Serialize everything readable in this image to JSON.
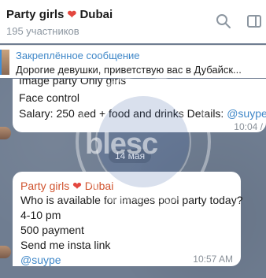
{
  "header": {
    "title": "Party girls",
    "title_emoji": "❤",
    "title_city": "Dubai",
    "subtitle": "195 участников"
  },
  "pinned": {
    "label": "Закреплённое сообщение",
    "text": "Дорогие девушки, приветствую вас в Дубайск..."
  },
  "messages": [
    {
      "lines": [
        "Image party Only girls",
        "Face control",
        "Salary: 250 aed + food and drinks Details: "
      ],
      "handle": "@suype",
      "time": "10:04 /"
    },
    {
      "sender": "Party girls",
      "sender_emoji": "❤",
      "sender_city": "Dubai",
      "lines": [
        "Who is available for images pool party today?",
        "4-10 pm",
        "500 payment",
        "Send me insta link"
      ],
      "handle": "@suype",
      "time": "10:57 AM"
    }
  ],
  "date_chip": "14 мая",
  "watermark": {
    "text": "blesc",
    "ring_text_top": "THE VICE CITY",
    "ring_text_bottom": "DEPARTMENT"
  },
  "icons": {
    "search": "search-icon",
    "panel": "side-panel-icon"
  },
  "colors": {
    "link": "#3f87c8",
    "sender": "#d0532e",
    "chat_bg": "#6f7d91"
  }
}
